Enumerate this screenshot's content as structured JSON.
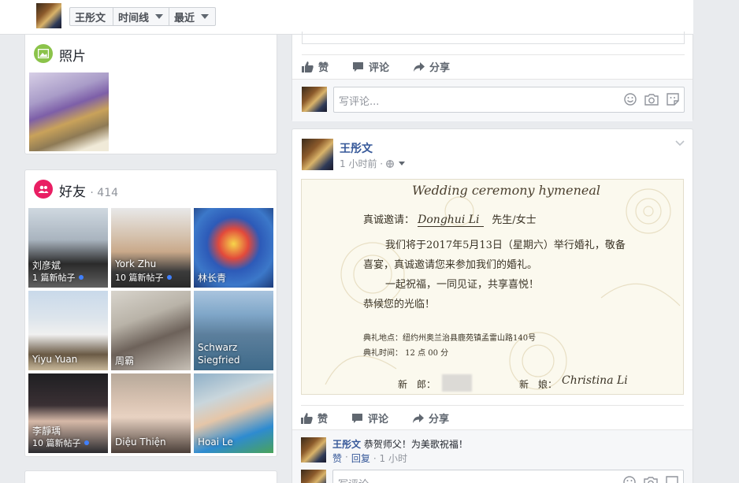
{
  "topbar": {
    "profile_tab": "王彤文",
    "timeline_tab": "时间线",
    "recent_tab": "最近"
  },
  "photos_card": {
    "title": "照片"
  },
  "friends_card": {
    "title": "好友",
    "count": "· 414",
    "friends": [
      {
        "name": "刘彦斌",
        "sub": "1 篇新帖子"
      },
      {
        "name": "York Zhu",
        "sub": "10 篇新帖子"
      },
      {
        "name": "林长青",
        "sub": ""
      },
      {
        "name": "Yiyu Yuan",
        "sub": ""
      },
      {
        "name": "周霸",
        "sub": ""
      },
      {
        "name": "Schwarz Siegfried",
        "sub": ""
      },
      {
        "name": "李靜瑀",
        "sub": "10 篇新帖子"
      },
      {
        "name": "Diệu Thiện",
        "sub": ""
      },
      {
        "name": "Hoai Le",
        "sub": ""
      }
    ]
  },
  "post_actions": {
    "like": "赞",
    "comment": "评论",
    "share": "分享"
  },
  "comment_placeholder": "写评论...",
  "post": {
    "author": "王彤文",
    "time": "1 小时前 ·",
    "invitation": {
      "heading": "Wedding ceremony hymeneal",
      "line1_prefix": "真诚邀请：",
      "line1_name": "Donghui Li",
      "line1_suffix": "先生/女士",
      "line2": "我们将于2017年5月13日（星期六）举行婚礼，敬备",
      "line3": "喜宴，真诚邀请您来参加我们的婚礼。",
      "line4": "一起祝福，一同见证，共享喜悦！",
      "line5": "恭候您的光临！",
      "venue": "典礼地点：纽约州奥兰治县鹿苑镇孟雷山路140号",
      "time": "典礼时间： 12 点 00 分",
      "groom_label": "新　郎：",
      "bride_label": "新　娘：",
      "bride_name": "Christina Li"
    }
  },
  "reply": {
    "author": "王彤文",
    "text": "恭贺师父！为美歌祝福！",
    "like": "赞",
    "reply": "回复",
    "time": "· 1 小时"
  }
}
